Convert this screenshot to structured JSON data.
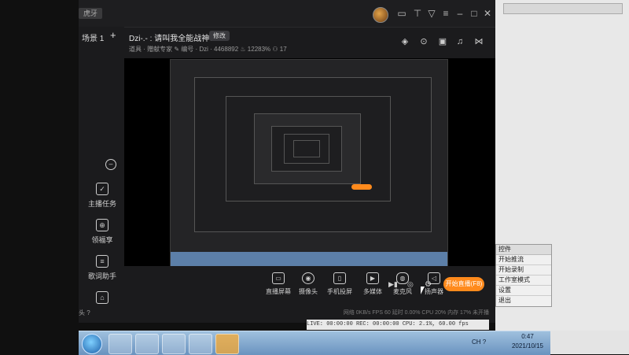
{
  "app": {
    "brand": "虎牙",
    "scene_label": "场景 1",
    "room_title": "Dzi-.- : 请叫我全能战神！",
    "edit_label": "修改",
    "room_meta": "道具 · 赠献专家  ✎  编号 · Dzi · 4468892  ♨ 12283%  ⚇ 17"
  },
  "sidebar": {
    "items": [
      {
        "label": "主播任务",
        "icon": "clipboard-check-icon"
      },
      {
        "label": "领福享",
        "icon": "gift-icon"
      },
      {
        "label": "歌词助手",
        "icon": "lyrics-icon"
      }
    ],
    "bottom_hint": "头 ?"
  },
  "toolbar": {
    "tools": [
      {
        "label": "直播屏幕",
        "icon": "screen-icon"
      },
      {
        "label": "摄像头",
        "icon": "camera-icon"
      },
      {
        "label": "手机投屏",
        "icon": "phone-cast-icon"
      },
      {
        "label": "多媒体",
        "icon": "media-icon"
      },
      {
        "label": "麦克风",
        "icon": "microphone-icon"
      },
      {
        "label": "扬声器",
        "icon": "speaker-icon"
      }
    ],
    "start_live": "开始直播(F8)"
  },
  "stats": {
    "text": "网络 0KB/s   FPS 60   延时 0.00%   CPU 20%   内存 17%   未开播"
  },
  "obs_status": {
    "text": "LIVE: 00:00:00   REC: 00:00:00   CPU: 2.1%, 60.00 fps"
  },
  "obs_controls": {
    "title": "控件",
    "items": [
      "开始推流",
      "开始录制",
      "工作室模式",
      "设置",
      "退出"
    ]
  },
  "taskbar": {
    "time": "0:47",
    "date": "2021/10/15",
    "tray": "CH ?"
  },
  "colors": {
    "accent": "#ff8a1c",
    "app_bg": "#1b1b1d",
    "taskbar": "#6a93bf"
  }
}
